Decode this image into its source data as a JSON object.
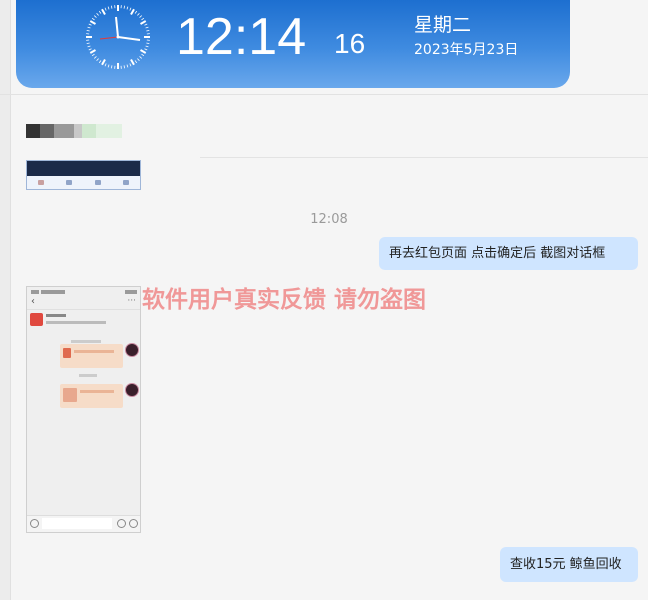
{
  "clock": {
    "time": "12:14",
    "seconds": "16",
    "weekday": "星期二",
    "date": "2023年5月23日"
  },
  "chat": {
    "timestamp": "12:08",
    "messages": [
      {
        "text": "再去红包页面  点击确定后    截图对话框"
      },
      {
        "text": "查收15元  鲸鱼回收"
      }
    ],
    "watermark": "软件用户真实反馈  请勿盗图"
  },
  "colors": {
    "banner": "#1d6fd0",
    "bubble": "#cfe5ff",
    "watermark": "#f08f8f"
  }
}
